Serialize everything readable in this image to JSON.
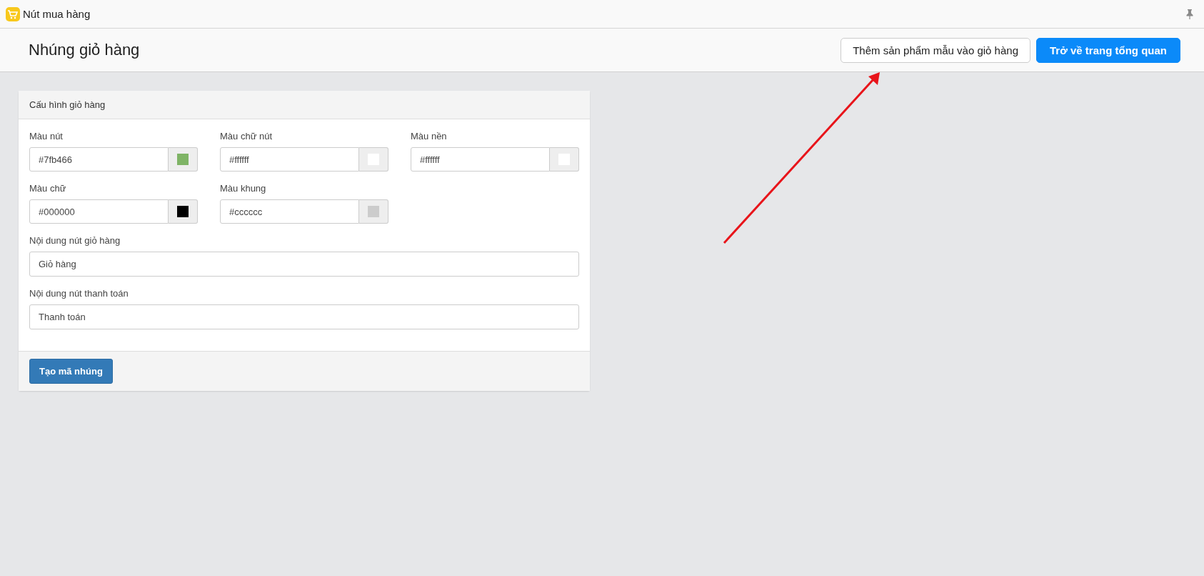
{
  "window": {
    "title": "Nút mua hàng"
  },
  "header": {
    "title": "Nhúng giỏ hàng",
    "buttons": [
      {
        "label": "Thêm sản phẩm mẫu vào giỏ hàng",
        "kind": "default"
      },
      {
        "label": "Trở về trang tổng quan",
        "kind": "primary"
      }
    ]
  },
  "annotation": {
    "kind": "arrow"
  },
  "panel": {
    "title": "Cấu hình giỏ hàng",
    "color_fields": [
      {
        "label": "Màu nút",
        "value": "#7fb466",
        "color": "#7fb466"
      },
      {
        "label": "Màu chữ nút",
        "value": "#ffffff",
        "color": "#ffffff"
      },
      {
        "label": "Màu nền",
        "value": "#ffffff",
        "color": "#ffffff"
      },
      {
        "label": "Màu chữ",
        "value": "#000000",
        "color": "#000000"
      },
      {
        "label": "Màu khung",
        "value": "#cccccc",
        "color": "#cccccc"
      }
    ],
    "text_fields": [
      {
        "label": "Nội dung nút giỏ hàng",
        "value": "Giỏ hàng"
      },
      {
        "label": "Nội dung nút thanh toán",
        "value": "Thanh toán"
      }
    ],
    "submit": "Tạo mã nhúng"
  }
}
